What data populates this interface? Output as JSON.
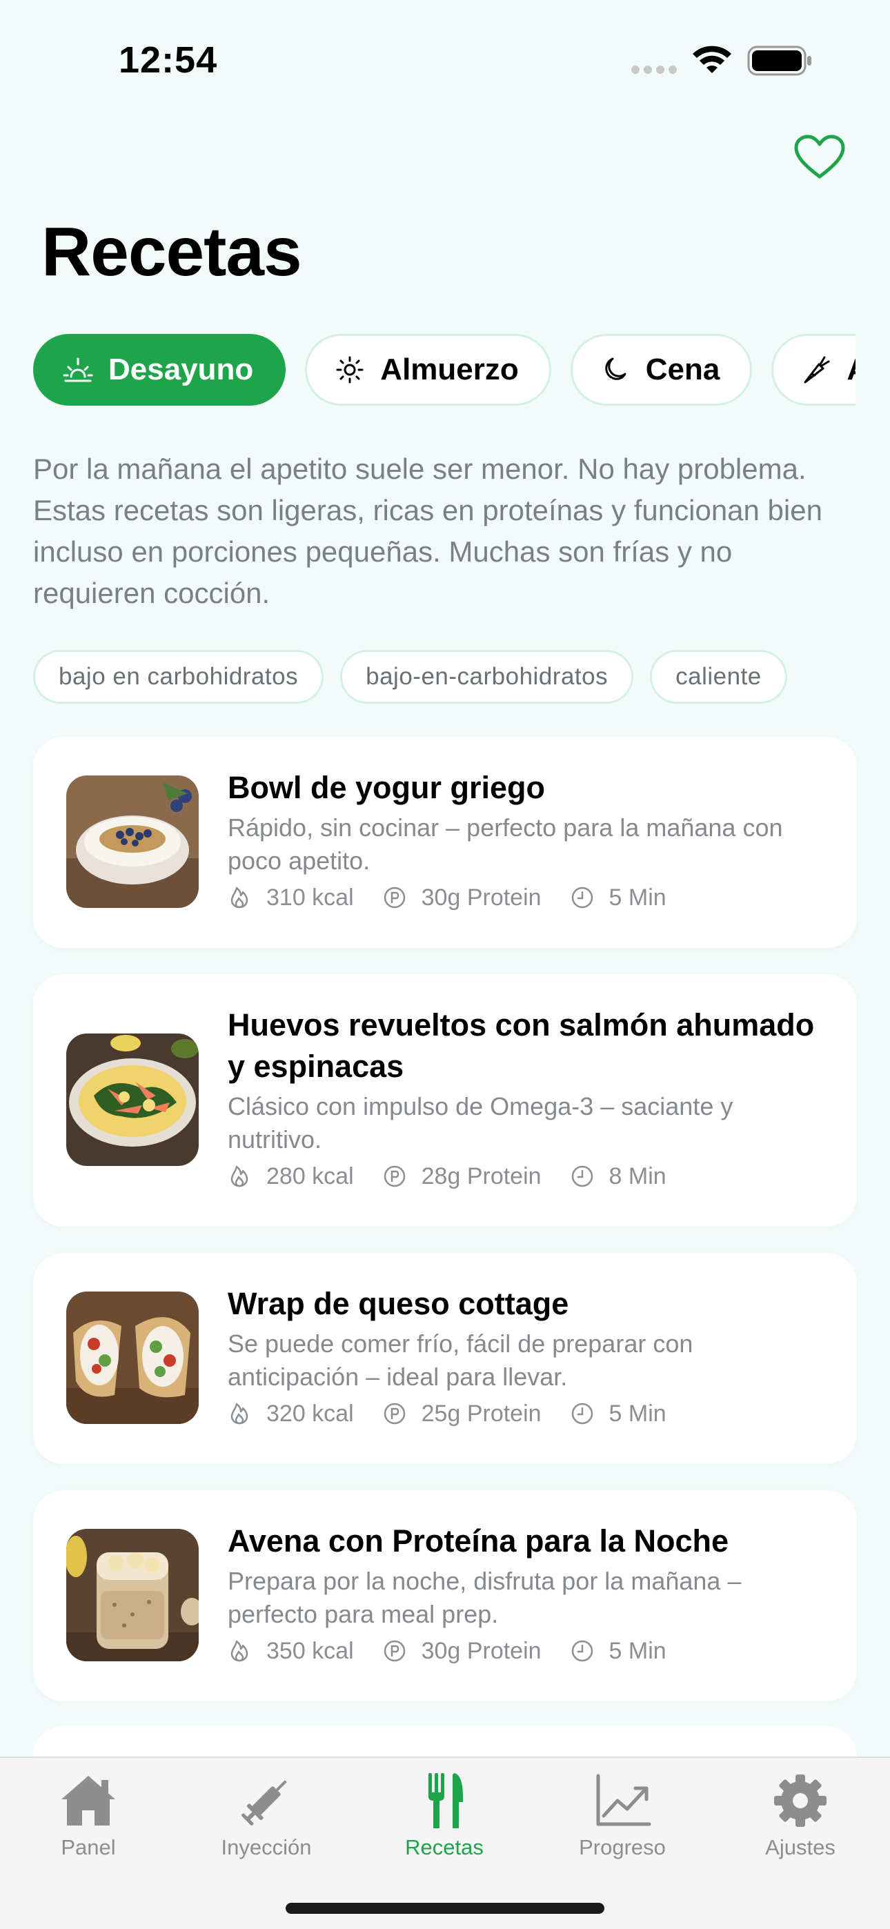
{
  "status_bar": {
    "time": "12:54"
  },
  "header": {
    "title": "Recetas",
    "favorites_icon": "heart-icon"
  },
  "categories": [
    {
      "label": "Desayuno",
      "icon": "sunrise-icon",
      "active": true
    },
    {
      "label": "Almuerzo",
      "icon": "sun-icon",
      "active": false
    },
    {
      "label": "Cena",
      "icon": "moon-icon",
      "active": false
    },
    {
      "label": "A",
      "icon": "carrot-icon",
      "active": false
    }
  ],
  "description": "Por la mañana el apetito suele ser menor. No hay problema. Estas recetas son ligeras, ricas en proteínas y funcionan bien incluso en porciones pequeñas. Muchas son frías y no requieren cocción.",
  "tags": [
    "bajo en carbohidratos",
    "bajo-en-carbohidratos",
    "caliente"
  ],
  "recipes": [
    {
      "title": "Bowl de yogur griego",
      "description": "Rápido, sin cocinar – perfecto para la mañana con poco apetito.",
      "kcal": "310 kcal",
      "protein": "30g Protein",
      "time": "5 Min"
    },
    {
      "title": "Huevos revueltos con salmón ahumado y espinacas",
      "description": "Clásico con impulso de Omega-3 – saciante y nutritivo.",
      "kcal": "280 kcal",
      "protein": "28g Protein",
      "time": "8 Min"
    },
    {
      "title": "Wrap de queso cottage",
      "description": "Se puede comer frío, fácil de preparar con anticipación – ideal para llevar.",
      "kcal": "320 kcal",
      "protein": "25g Protein",
      "time": "5 Min"
    },
    {
      "title": "Avena con Proteína para la Noche",
      "description": "Prepara por la noche, disfruta por la mañana – perfecto para meal prep.",
      "kcal": "350 kcal",
      "protein": "30g Protein",
      "time": "5 Min"
    }
  ],
  "tab_bar": {
    "items": [
      {
        "label": "Panel",
        "icon": "house-icon",
        "active": false
      },
      {
        "label": "Inyección",
        "icon": "syringe-icon",
        "active": false
      },
      {
        "label": "Recetas",
        "icon": "fork-knife-icon",
        "active": true
      },
      {
        "label": "Progreso",
        "icon": "chart-icon",
        "active": false
      },
      {
        "label": "Ajustes",
        "icon": "gear-icon",
        "active": false
      }
    ]
  },
  "colors": {
    "accent": "#1ea54c",
    "background": "#f3fbfa",
    "chip_border": "#d3f1e3"
  }
}
